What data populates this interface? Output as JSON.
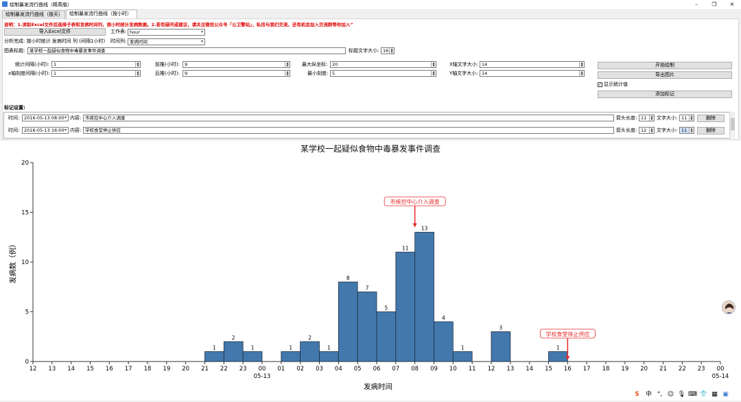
{
  "window": {
    "title": "绘制暴发流行曲线（精英版）",
    "minimize": "–",
    "maximize": "❐",
    "close": "✕"
  },
  "tabs": [
    {
      "label": "绘制暴发流行曲线（按天）"
    },
    {
      "label": "绘制暴发流行曲线（按小时）"
    }
  ],
  "note": "说明：1.读取Excel文件后选择子表和发病时间列，按小时统计发病数据。2.若有疑问或建议，请关注微信公众号「公卫警站」，私信与我们交流，还有机会加入交流群等你加入”",
  "controls": {
    "import_button": "导入Excel文件",
    "sheet_label": "工作表:",
    "sheet_value": "hour",
    "analysis_status": "分析完成: 按小时统计 发病时间 列 (间隔1小时)",
    "time_col_label": "时间列:",
    "time_col_value": "发病时间",
    "chart_title_label": "图表标题:",
    "chart_title_value": "某学校一起疑似食物中毒暴发事件调查",
    "title_font_label": "标题文字大小:",
    "title_font_value": "16",
    "interval_label": "统计间隔(小时):",
    "interval_value": "1",
    "x_tick_label": "x轴刻度间隔(小时):",
    "x_tick_value": "1",
    "pre_label": "前推(小时):",
    "pre_value": "9",
    "post_label": "后推(小时):",
    "post_value": "9",
    "max_y_label": "最大纵坐标:",
    "max_y_value": "20",
    "min_tick_label": "最小刻度:",
    "min_tick_value": "5",
    "x_font_label": "X轴文字大小:",
    "x_font_value": "14",
    "y_font_label": "Y轴文字大小:",
    "y_font_value": "14",
    "start_button": "开始绘制",
    "export_button": "导出图片",
    "show_stats_label": "显示统计值",
    "add_mark_button": "添加标记"
  },
  "marks_section_title": "标记设置:",
  "marks": [
    {
      "time_label": "时间:",
      "time": "2016-05-13 08:00",
      "content_label": "内容:",
      "content": "市疾控中心介入调查",
      "arrow_label": "箭头长度:",
      "arrow": "11",
      "font_label": "文字大小:",
      "font": "11",
      "delete": "删除"
    },
    {
      "time_label": "时间:",
      "time": "2016-05-13 16:00",
      "content_label": "内容:",
      "content": "学校食堂停止供应",
      "arrow_label": "箭头长度:",
      "arrow": "12",
      "font_label": "文字大小:",
      "font": "11",
      "delete": "删除"
    }
  ],
  "colors": {
    "bar": "#4378ad",
    "annotation": "#e8282a"
  },
  "chart_data": {
    "type": "bar",
    "title": "某学校一起疑似食物中毒暴发事件调查",
    "xlabel": "发病时间",
    "ylabel": "发病数（例）",
    "ylim": [
      0,
      20
    ],
    "yticks": [
      0,
      5,
      10,
      15,
      20
    ],
    "xtick_labels": [
      "12",
      "13",
      "14",
      "15",
      "16",
      "17",
      "18",
      "19",
      "20",
      "21",
      "22",
      "23",
      "00",
      "01",
      "02",
      "03",
      "04",
      "05",
      "06",
      "07",
      "08",
      "09",
      "10",
      "11",
      "12",
      "13",
      "14",
      "15",
      "16",
      "17",
      "18",
      "19",
      "20",
      "21",
      "22",
      "23",
      "00"
    ],
    "date_labels": [
      {
        "tick": 12,
        "text": "05-13"
      },
      {
        "tick": 36,
        "text": "05-14"
      }
    ],
    "bars": [
      {
        "start": 9,
        "value": 1
      },
      {
        "start": 10,
        "value": 2
      },
      {
        "start": 11,
        "value": 1
      },
      {
        "start": 13,
        "value": 1
      },
      {
        "start": 14,
        "value": 2
      },
      {
        "start": 15,
        "value": 1
      },
      {
        "start": 16,
        "value": 8
      },
      {
        "start": 17,
        "value": 7
      },
      {
        "start": 18,
        "value": 5
      },
      {
        "start": 19,
        "value": 11
      },
      {
        "start": 20,
        "value": 13
      },
      {
        "start": 21,
        "value": 4
      },
      {
        "start": 22,
        "value": 1
      },
      {
        "start": 24,
        "value": 3
      },
      {
        "start": 27,
        "value": 1
      }
    ],
    "annotations": [
      {
        "tick": 20,
        "text": "市疾控中心介入调查",
        "value": 16
      },
      {
        "tick": 28,
        "text": "学校食堂停止供应",
        "value": 2.7
      }
    ]
  },
  "taskbar": {
    "ime_label": "中",
    "icons": [
      "sogou-icon",
      "ime-icon",
      "punctuation-icon",
      "emoji-icon",
      "mic-icon",
      "keyboard-icon",
      "skin-icon",
      "grid-icon"
    ]
  }
}
